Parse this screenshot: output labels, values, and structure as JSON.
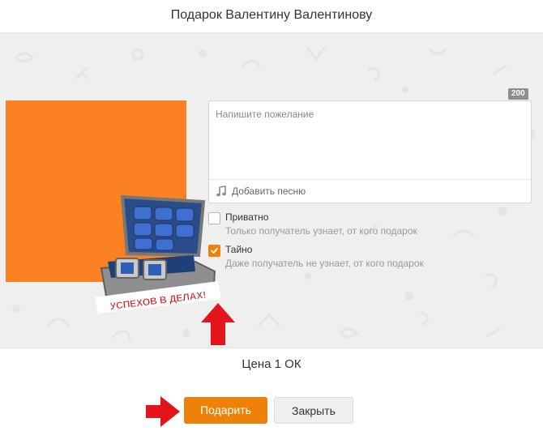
{
  "dialog": {
    "title": "Подарок Валентину Валентинову"
  },
  "gift": {
    "image_color": "#fb8122",
    "sticker_text": "УСПЕХОВ В ДЕЛАХ!"
  },
  "wish": {
    "placeholder": "Напишите пожелание",
    "value": "",
    "char_limit": "200",
    "add_song_label": "Добавить песню"
  },
  "options": [
    {
      "label": "Приватно",
      "hint": "Только получатель узнает, от кого подарок",
      "checked": false
    },
    {
      "label": "Тайно",
      "hint": "Даже получатель не узнает, от кого подарок",
      "checked": true
    }
  ],
  "price": {
    "text": "Цена 1 ОК"
  },
  "buttons": {
    "gift_label": "Подарить",
    "close_label": "Закрыть"
  },
  "colors": {
    "accent": "#ee8208",
    "annotation_arrow": "#e3141c",
    "background_pattern": "#efefef"
  }
}
